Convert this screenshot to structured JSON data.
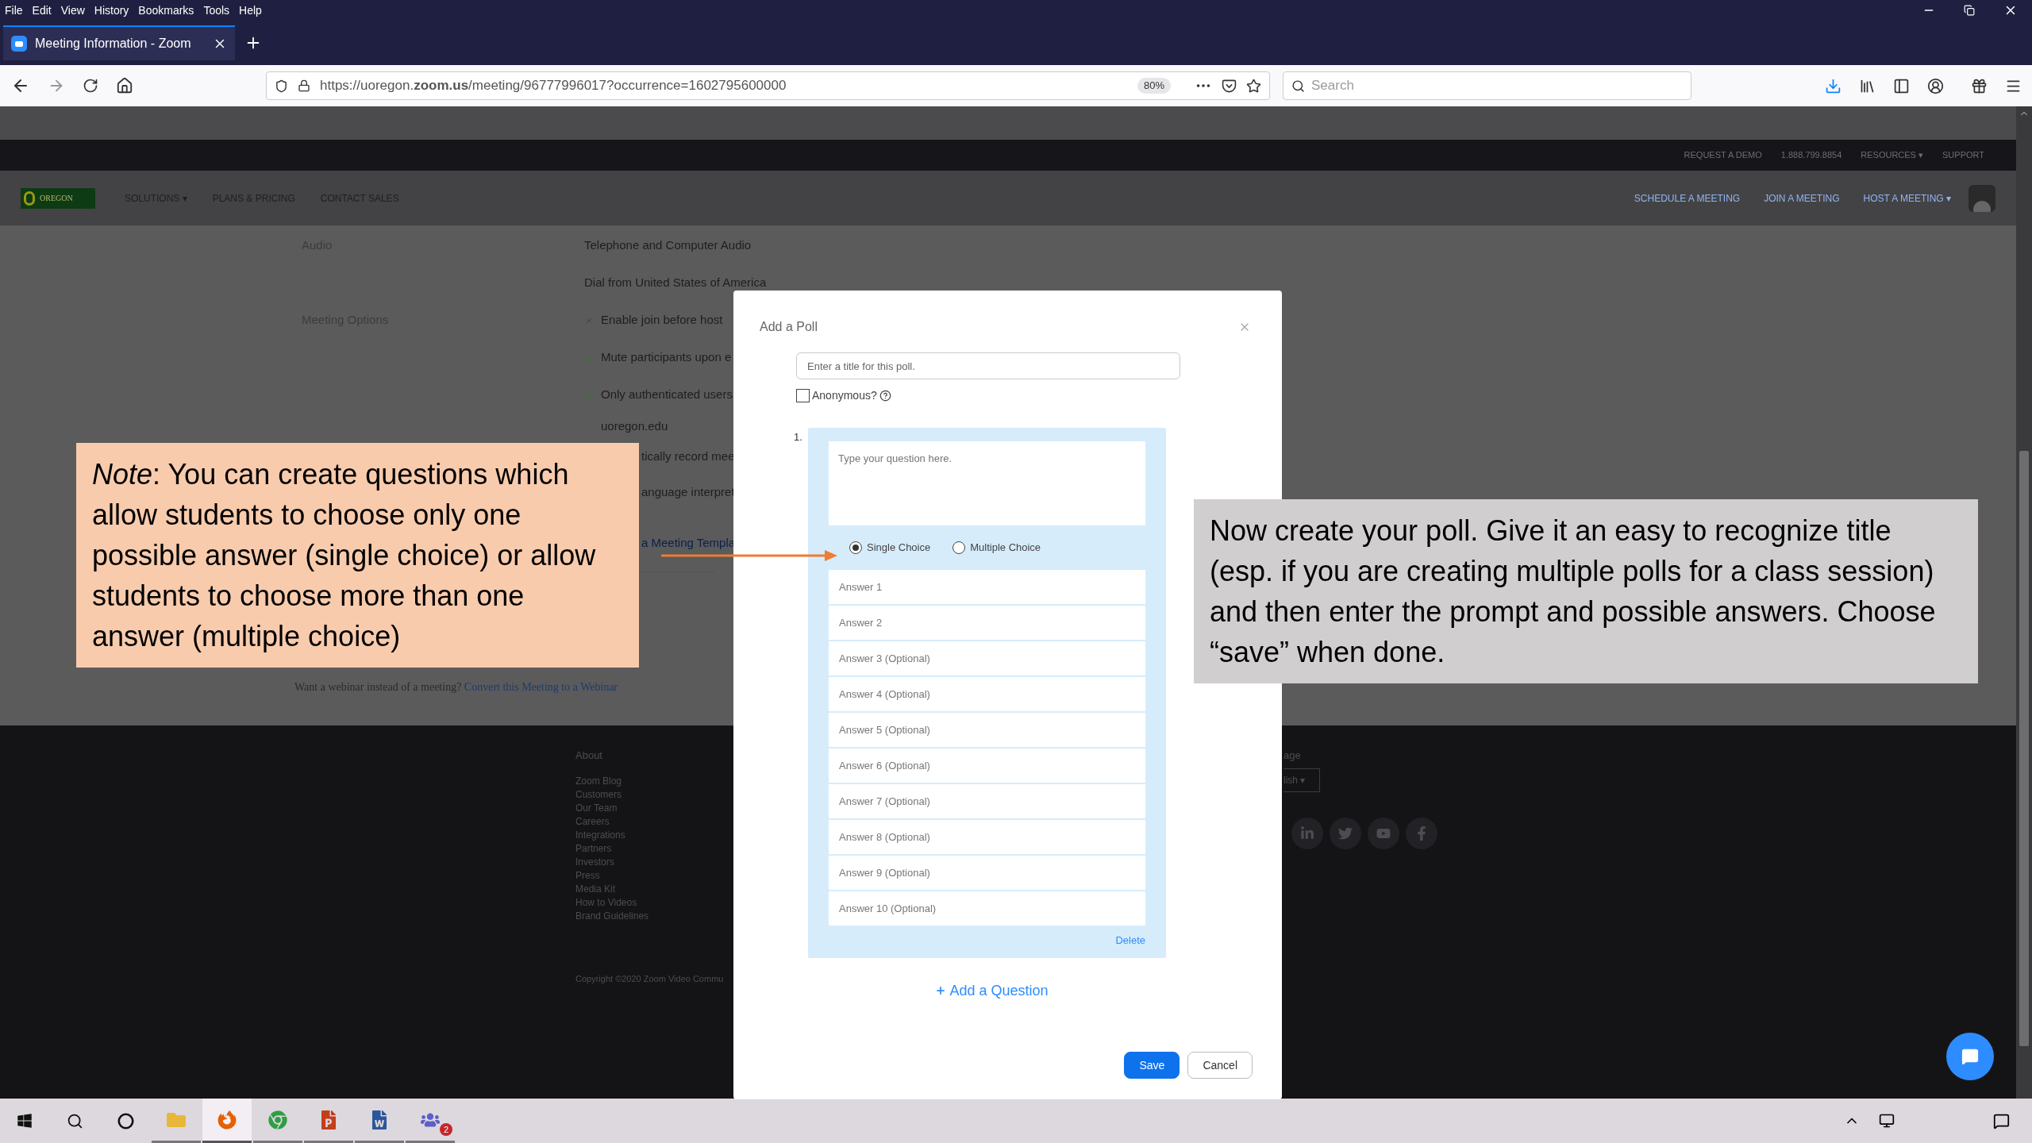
{
  "browser": {
    "menu": [
      "File",
      "Edit",
      "View",
      "History",
      "Bookmarks",
      "Tools",
      "Help"
    ],
    "tab": {
      "title": "Meeting Information - Zoom",
      "selected": true
    },
    "url": "https://uoregon.**zoom.us**/meeting/96777996017?occurrence=1602795600000",
    "zoom": "80%",
    "search": {
      "placeholder": "Search"
    }
  },
  "site": {
    "top_links": [
      "REQUEST A DEMO",
      "1.888.799.8854",
      "RESOURCES ▾",
      "SUPPORT"
    ],
    "logo_text": "OREGON",
    "nav": [
      "SOLUTIONS ▾",
      "PLANS & PRICING",
      "CONTACT SALES"
    ],
    "nav_right": [
      "SCHEDULE A MEETING",
      "JOIN A MEETING",
      "HOST A MEETING ▾"
    ]
  },
  "details": [
    {
      "label": "Audio",
      "items": [
        {
          "text": "Telephone and Computer Audio",
          "kind": "text"
        },
        {
          "text": "Dial from United States of America",
          "kind": "text"
        }
      ]
    },
    {
      "label": "Meeting Options",
      "items": [
        {
          "text": "Enable join before host",
          "kind": "cross"
        },
        {
          "text": "Mute participants upon e",
          "kind": "check"
        },
        {
          "text": "Only authenticated users",
          "kind": "check"
        },
        {
          "text": "uoregon.edu",
          "kind": "continuation"
        },
        {
          "text": "tically record mee",
          "kind": "partial"
        },
        {
          "text": "anguage interpret",
          "kind": "partial"
        }
      ]
    }
  ],
  "template_link": "a Meeting Templa",
  "webinar": {
    "text": "Want a webinar instead of a meeting?",
    "link": "Convert this Meeting to a Webinar"
  },
  "footer": {
    "heading": "About",
    "links": [
      "Zoom Blog",
      "Customers",
      "Our Team",
      "Careers",
      "Integrations",
      "Partners",
      "Investors",
      "Press",
      "Media Kit",
      "How to Videos",
      "Brand Guidelines"
    ],
    "copyright": "Copyright ©2020 Zoom Video Commu",
    "language_label": "age",
    "language": "lish ▾"
  },
  "dialog": {
    "title": "Add a Poll",
    "title_field": {
      "placeholder": "Enter a title for this poll."
    },
    "anonymous": {
      "label": "Anonymous?",
      "checked": false
    },
    "question": {
      "number": "1.",
      "placeholder": "Type your question here.",
      "choices": [
        {
          "label": "Single Choice",
          "selected": true
        },
        {
          "label": "Multiple Choice",
          "selected": false
        }
      ],
      "answers": [
        {
          "placeholder": "Answer 1"
        },
        {
          "placeholder": "Answer 2"
        },
        {
          "placeholder": "Answer 3 (Optional)"
        },
        {
          "placeholder": "Answer 4 (Optional)"
        },
        {
          "placeholder": "Answer 5 (Optional)"
        },
        {
          "placeholder": "Answer 6 (Optional)"
        },
        {
          "placeholder": "Answer 7 (Optional)"
        },
        {
          "placeholder": "Answer 8 (Optional)"
        },
        {
          "placeholder": "Answer 9 (Optional)"
        },
        {
          "placeholder": "Answer 10 (Optional)"
        }
      ],
      "delete": "Delete"
    },
    "add_question": "Add a Question",
    "buttons": [
      {
        "label": "Save",
        "kind": "primary"
      },
      {
        "label": "Cancel",
        "kind": "secondary"
      }
    ]
  },
  "notes": [
    {
      "kind": "note",
      "text": "*Note*: You can create questions which allow students to choose only one possible answer (single choice) or allow students to choose more than one answer (multiple choice)"
    },
    {
      "kind": "info",
      "text": "Now create your poll. Give it an easy to recognize title (esp. if you are creating multiple polls for a class session) and then enter the prompt and possible answers. Choose “save” when done."
    }
  ],
  "taskbar": {
    "apps": [
      {
        "kind": "explorer",
        "selected": false
      },
      {
        "kind": "firefox",
        "selected": true
      },
      {
        "kind": "chrome",
        "selected": false
      },
      {
        "kind": "powerpoint",
        "selected": false
      },
      {
        "kind": "word",
        "selected": false
      },
      {
        "kind": "teams",
        "selected": false,
        "badge": "2"
      }
    ]
  }
}
